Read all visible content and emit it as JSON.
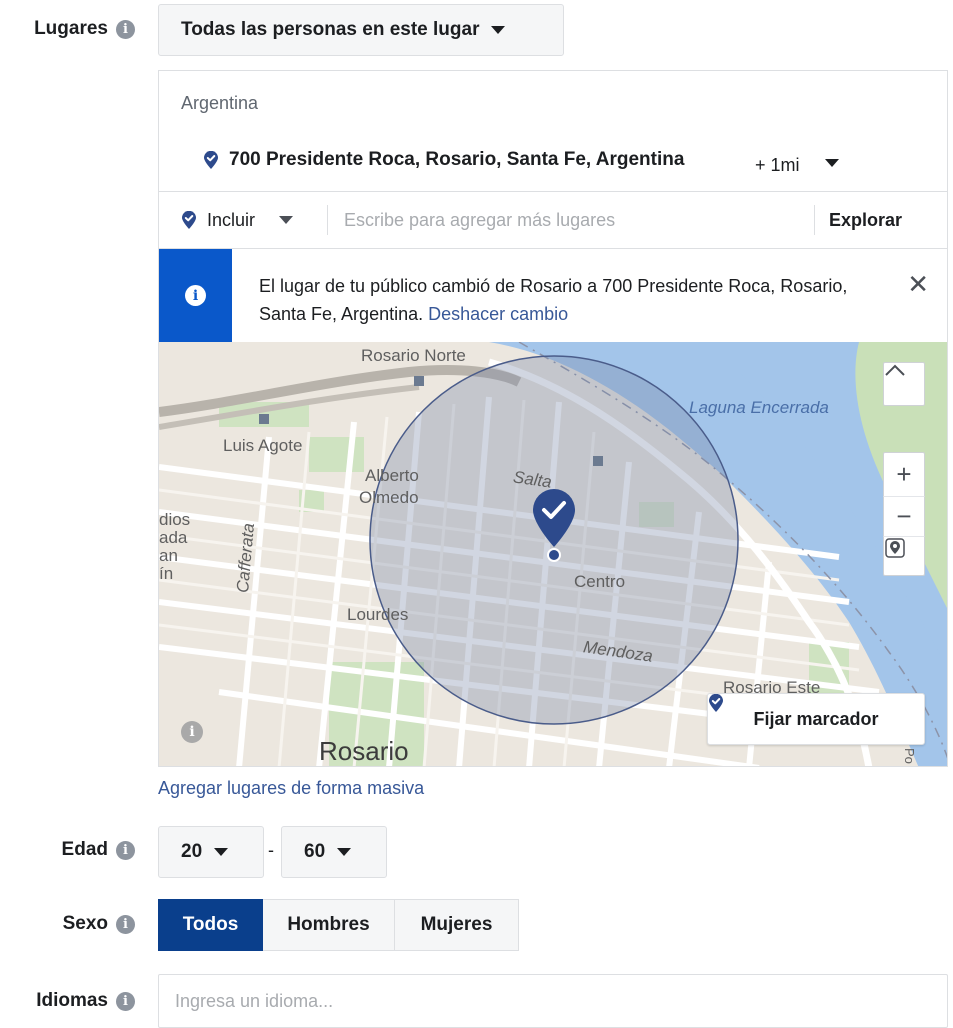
{
  "places": {
    "label": "Lugares",
    "audience_selector": "Todas las personas en este lugar"
  },
  "location": {
    "country": "Argentina",
    "address": "700 Presidente Roca, Rosario, Santa Fe, Argentina",
    "radius": "+ 1mi",
    "include_label": "Incluir",
    "search_placeholder": "Escribe para agregar más lugares",
    "explore_label": "Explorar"
  },
  "notice": {
    "text": "El lugar de tu público cambió de Rosario a 700 Presidente Roca, Rosario, Santa Fe, Argentina.",
    "undo_link": "Deshacer cambio"
  },
  "map": {
    "labels": {
      "rosario_norte": "Rosario Norte",
      "laguna": "Laguna Encerrada",
      "luis_agote": "Luis Agote",
      "alberto": "Alberto",
      "olmedo": "Olmedo",
      "salta": "Salta",
      "dios": "dios",
      "ada": "ada",
      "an": "an",
      "in": "ín",
      "cafferata": "Cafferata",
      "centro": "Centro",
      "lourdes": "Lourdes",
      "mendoza": "Mendoza",
      "rosario_este": "Rosario Este",
      "rosario": "Rosario",
      "edge": "Po"
    },
    "fix_marker_label": "Fijar marcador"
  },
  "bulk_link": "Agregar lugares de forma masiva",
  "age": {
    "label": "Edad",
    "min": "20",
    "separator": "-",
    "max": "60"
  },
  "gender": {
    "label": "Sexo",
    "options": [
      "Todos",
      "Hombres",
      "Mujeres"
    ],
    "selected": "Todos"
  },
  "languages": {
    "label": "Idiomas",
    "placeholder": "Ingresa un idioma..."
  },
  "colors": {
    "accent": "#0a58ca",
    "selected_segment": "#0a3f8c",
    "link": "#385898",
    "pin": "#2d4a8c"
  }
}
